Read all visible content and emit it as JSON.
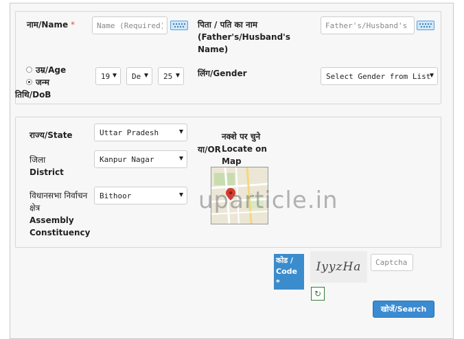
{
  "personal": {
    "name_label": "नाम/Name",
    "name_required_mark": "*",
    "name_placeholder": "Name (Required)",
    "relative_label": "पिता / पति का नाम (Father's/Husband's Name)",
    "relative_placeholder": "Father's/Husband's n",
    "age_label": "उम्र/Age",
    "dob_label": "जन्म तिथि/DoB",
    "dob_day": "19",
    "dob_month": "De",
    "dob_year": "25",
    "gender_label": "लिंग/Gender",
    "gender_value": "Select Gender from List"
  },
  "location": {
    "state_label": "राज्य/State",
    "state_value": "Uttar Pradesh",
    "district_label_hi": "जिला",
    "district_label_en": "District",
    "district_value": "Kanpur Nagar",
    "ac_label_hi": "विधानसभा निर्वाचन क्षेत्र",
    "ac_label_en": "Assembly Constituency",
    "ac_value": "Bithoor",
    "or_label": "या/OR",
    "map_label": "नक्शे पर चुने Locate on Map"
  },
  "captcha": {
    "label": "कोड / Code",
    "required_mark": "*",
    "image_text": "IyyzHa",
    "placeholder": "Captcha"
  },
  "search_button": "खोजें/Search",
  "watermark": "uparticle.in"
}
